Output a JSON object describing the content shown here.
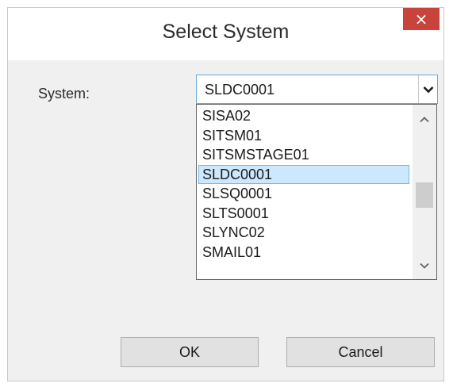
{
  "dialog": {
    "title": "Select System",
    "close_label": "×"
  },
  "form": {
    "system_label": "System:",
    "selected_value": "SLDC0001",
    "options": [
      "SISA02",
      "SITSM01",
      "SITSMSTAGE01",
      "SLDC0001",
      "SLSQ0001",
      "SLTS0001",
      "SLYNC02",
      "SMAIL01"
    ],
    "selected_index": 3
  },
  "buttons": {
    "ok_label": "OK",
    "cancel_label": "Cancel"
  },
  "icons": {
    "combo_arrow": "chevron-down-icon",
    "scroll_up": "chevron-up-icon",
    "scroll_down": "chevron-down-icon"
  },
  "colors": {
    "close_button": "#c7433b",
    "selection_background": "#cce8ff",
    "selection_border": "#7ab4e4",
    "combo_focus_border": "#6aa6da"
  }
}
